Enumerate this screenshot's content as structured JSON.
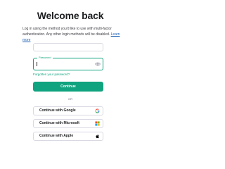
{
  "header": {
    "title": "Welcome back",
    "subtitle_text": "Log in using the method you'd like to use with multi-factor authentication. Any other login methods will be disabled.",
    "learn_more_label": "Learn more"
  },
  "form": {
    "email_value": "",
    "password_label": "Password",
    "password_value": "",
    "forgot_password_label": "Forgotten your password?",
    "continue_label": "Continue"
  },
  "divider": {
    "or_label": "OR"
  },
  "sso": {
    "google": {
      "label": "Continue with Google",
      "icon": "google-icon"
    },
    "microsoft": {
      "label": "Continue with Microsoft",
      "icon": "microsoft-icon"
    },
    "apple": {
      "label": "Continue with Apple",
      "icon": "apple-icon"
    }
  },
  "colors": {
    "accent": "#10a37f",
    "link": "#1a5fb4",
    "border": "#d9d9e3"
  }
}
